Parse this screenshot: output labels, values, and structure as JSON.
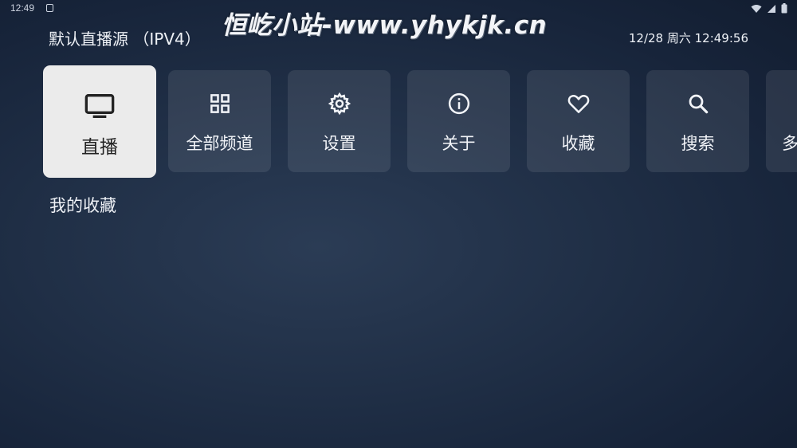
{
  "status_bar": {
    "time": "12:49",
    "icons": [
      "wifi-icon",
      "signal-icon",
      "battery-icon"
    ]
  },
  "watermark": "恒屹小站-www.yhykjk.cn",
  "header": {
    "source_title": "默认直播源 （IPV4）",
    "datetime": "12/28 周六 12:49:56"
  },
  "menu": {
    "items": [
      {
        "label": "直播",
        "icon": "tv-icon",
        "selected": true
      },
      {
        "label": "全部频道",
        "icon": "grid-icon",
        "selected": false
      },
      {
        "label": "设置",
        "icon": "gear-icon",
        "selected": false
      },
      {
        "label": "关于",
        "icon": "info-icon",
        "selected": false
      },
      {
        "label": "收藏",
        "icon": "heart-icon",
        "selected": false
      },
      {
        "label": "搜索",
        "icon": "search-icon",
        "selected": false
      },
      {
        "label": "多",
        "icon": "more-icon",
        "selected": false
      }
    ]
  },
  "favorites": {
    "section_title": "我的收藏"
  },
  "colors": {
    "background": "#1f2e45",
    "tile": "#3a4962",
    "tile_selected": "#ebebeb",
    "text": "#eef1f6"
  }
}
